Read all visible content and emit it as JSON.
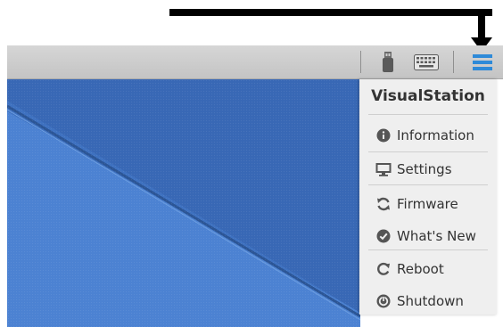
{
  "menu": {
    "title": "VisualStation",
    "items": [
      {
        "label": "Information",
        "icon": "info-icon"
      },
      {
        "label": "Settings",
        "icon": "monitor-icon"
      },
      {
        "label": "Firmware",
        "icon": "sync-icon"
      },
      {
        "label": "What's New",
        "icon": "check-circle-icon"
      },
      {
        "label": "Reboot",
        "icon": "reboot-icon"
      },
      {
        "label": "Shutdown",
        "icon": "power-icon"
      }
    ]
  },
  "taskbar": {
    "icons": [
      "usb-drive-icon",
      "keyboard-icon",
      "hamburger-menu-icon"
    ]
  },
  "colors": {
    "desktop": "#3b6ebd",
    "menu_accent": "#2e8ad8",
    "icon_gray": "#555555"
  }
}
